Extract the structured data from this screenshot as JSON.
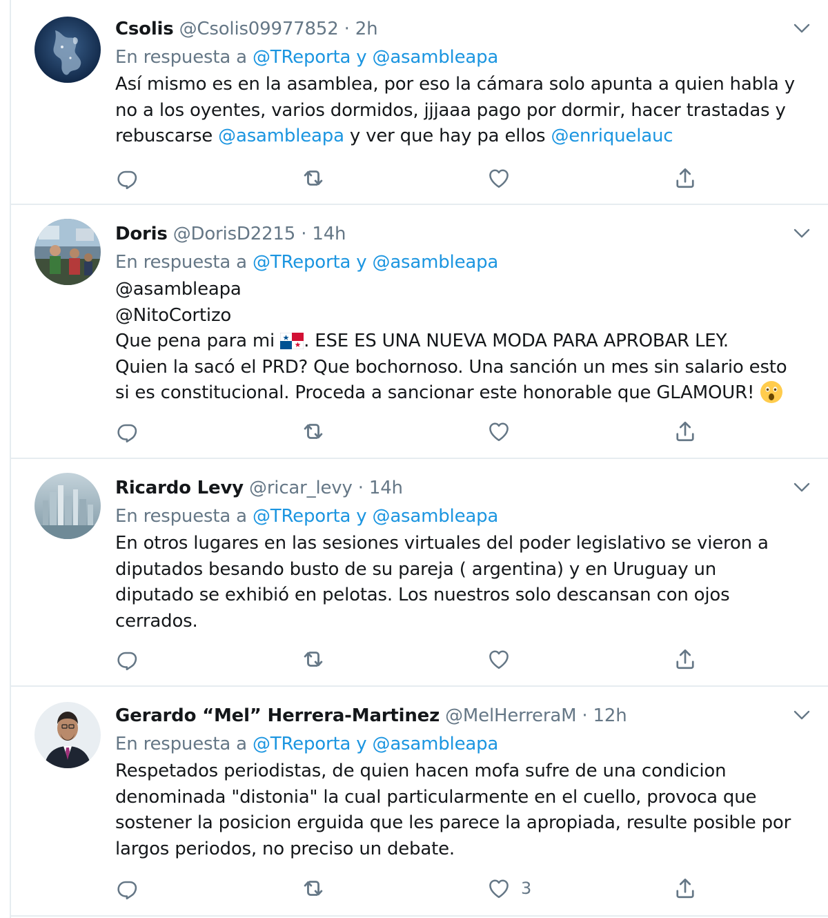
{
  "reply_prefix": "En respuesta a",
  "and_word": "y",
  "colors": {
    "link": "#1b95e0",
    "secondary": "#657786",
    "text": "#14171a",
    "divider": "#e6ecf0"
  },
  "tweets": [
    {
      "name": "Csolis",
      "handle": "@Csolis09977852",
      "sep": "·",
      "time": "2h",
      "reply_to": [
        "@TReporta",
        "@asambleapa"
      ],
      "text_lines": [
        "Así mismo es en la asamblea, por eso la cámara solo apunta a quien habla y",
        "no a los oyentes, varios dormidos, jjjaaa pago por dormir, hacer trastadas y"
      ],
      "last_line": {
        "a": "rebuscarse ",
        "m1": "@asambleapa",
        "b": " y ver que hay pa ellos ",
        "m2": "@enriquelauc"
      },
      "likes": ""
    },
    {
      "name": "Doris",
      "handle": "@DorisD2215",
      "sep": "·",
      "time": "14h",
      "reply_to": [
        "@TReporta",
        "@asambleapa"
      ],
      "mention_lines": [
        "@asambleapa",
        "@NitoCortizo"
      ],
      "first_line": {
        "a": "Que pena para mi ",
        "b": ". ESE ES UNA NUEVA MODA PARA APROBAR LEY."
      },
      "text_lines": [
        "Quien la sacó el PRD? Que bochornoso. Una sanción un mes sin salario esto",
        "si es constitucional. Proceda  a sancionar este honorable que GLAMOUR! "
      ],
      "flag_icon": "panama-flag-emoji",
      "emoji_icon": "astonished-face-emoji",
      "likes": ""
    },
    {
      "name": "Ricardo Levy",
      "handle": "@ricar_levy",
      "sep": "·",
      "time": "14h",
      "reply_to": [
        "@TReporta",
        "@asambleapa"
      ],
      "text_lines": [
        "En otros lugares en las sesiones virtuales del poder legislativo se vieron a",
        "diputados besando busto de su pareja ( argentina) y en Uruguay un",
        "diputado se exhibió en pelotas. Los nuestros solo descansan con ojos",
        "cerrados."
      ],
      "likes": ""
    },
    {
      "name": "Gerardo “Mel” Herrera-Martinez",
      "handle": "@MelHerreraM",
      "sep": "·",
      "time": "12h",
      "reply_to": [
        "@TReporta",
        "@asambleapa"
      ],
      "text_lines": [
        "Respetados periodistas, de quien hacen mofa sufre de una condicion",
        "denominada \"distonia\" la cual particularmente en el cuello, provoca que",
        "sostener la posicion erguida que les parece la apropiada, resulte posible por",
        "largos periodos, no preciso un debate."
      ],
      "likes": "3"
    }
  ],
  "icons": [
    "reply-icon",
    "retweet-icon",
    "like-icon",
    "share-icon",
    "chevron-down-icon"
  ]
}
